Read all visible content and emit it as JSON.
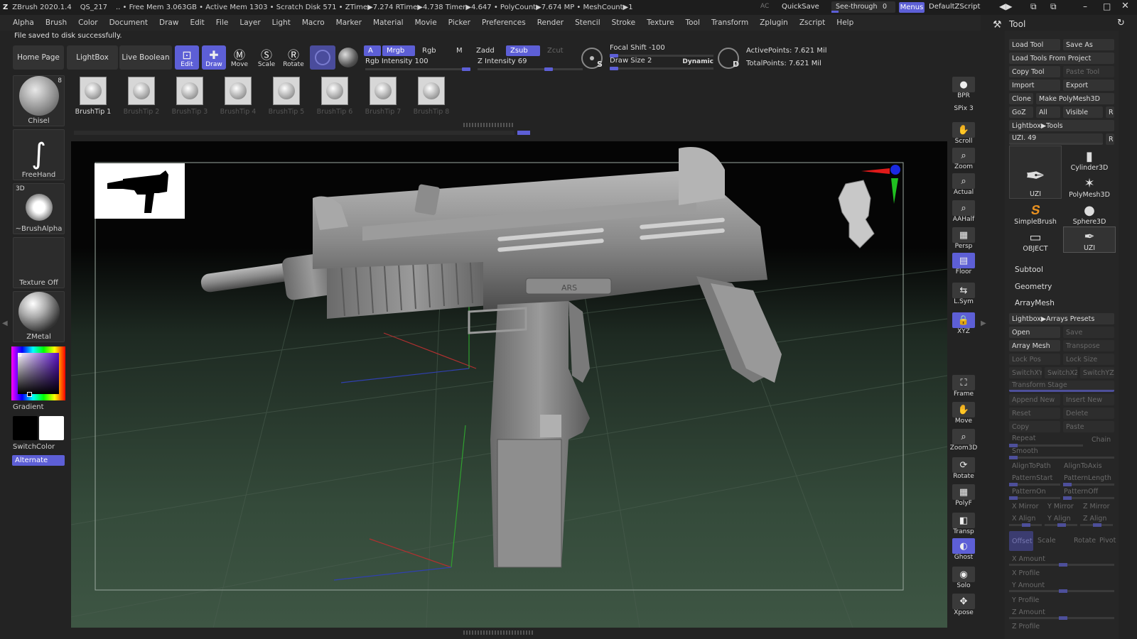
{
  "titlebar": {
    "app": "ZBrush 2020.1.4",
    "doc": "QS_217",
    "stats": ".. • Free Mem 3.063GB • Active Mem 1303 • Scratch Disk 571 • ZTime▶7.274 RTime▶4.738 Timer▶4.647 • PolyCount▶7.674 MP • MeshCount▶1",
    "ac": "AC",
    "quicksave": "QuickSave",
    "seethrough": "See-through",
    "seethrough_value": "0",
    "menus": "Menus",
    "script": "DefaultZScript"
  },
  "menubar": [
    "Alpha",
    "Brush",
    "Color",
    "Document",
    "Draw",
    "Edit",
    "File",
    "Layer",
    "Light",
    "Macro",
    "Marker",
    "Material",
    "Movie",
    "Picker",
    "Preferences",
    "Render",
    "Stencil",
    "Stroke",
    "Texture",
    "Tool",
    "Transform",
    "Zplugin",
    "Zscript",
    "Help"
  ],
  "status": "File saved to disk successfully.",
  "topbar": {
    "home": "Home Page",
    "lightbox": "LightBox",
    "liveboolean": "Live Boolean",
    "modes": [
      "Edit",
      "Draw",
      "Move",
      "Scale",
      "Rotate"
    ],
    "a": "A",
    "mrgb": "Mrgb",
    "rgb": "Rgb",
    "m": "M",
    "zadd": "Zadd",
    "zsub": "Zsub",
    "zcut": "Zcut",
    "rgb_intensity": "Rgb Intensity 100",
    "z_intensity": "Z Intensity 69",
    "focal_shift": "Focal Shift -100",
    "draw_size": "Draw Size 2",
    "dynamic": "Dynamic",
    "s": "S",
    "d": "D",
    "active_points": "ActivePoints: 7.621 Mil",
    "total_points": "TotalPoints: 7.621 Mil",
    "rgb_intensity_level": 1.0,
    "z_intensity_level": 0.69
  },
  "left": {
    "brush": "Chisel",
    "brush_count": "8",
    "stroke": "FreeHand",
    "alpha_tag": "3D",
    "alpha": "~BrushAlpha",
    "texture": "Texture Off",
    "material": "ZMetal",
    "gradient": "Gradient",
    "switchcolor": "SwitchColor",
    "alternate": "Alternate"
  },
  "brushtips": [
    "BrushTip 1",
    "BrushTip 2",
    "BrushTip 3",
    "BrushTip 4",
    "BrushTip 5",
    "BrushTip 6",
    "BrushTip 7",
    "BrushTip 8"
  ],
  "viewport": {
    "stamp": "ARS"
  },
  "rightshelf": [
    {
      "label": "BPR",
      "icon": "sphere-icon"
    },
    {
      "label": "SPix 3",
      "icon": "none"
    },
    {
      "label": "Scroll",
      "icon": "hand-icon"
    },
    {
      "label": "Zoom",
      "icon": "zoom-icon"
    },
    {
      "label": "Actual",
      "icon": "zoom-icon"
    },
    {
      "label": "AAHalf",
      "icon": "zoom-icon"
    },
    {
      "label": "Persp",
      "icon": "grid-icon"
    },
    {
      "label": "Floor",
      "icon": "floor-icon"
    },
    {
      "label": "L.Sym",
      "icon": "sym-icon"
    },
    {
      "label": "XYZ",
      "icon": "lock-icon"
    },
    {
      "label": "Frame",
      "icon": "frame-icon"
    },
    {
      "label": "Move",
      "icon": "hand-icon"
    },
    {
      "label": "Zoom3D",
      "icon": "zoom-icon"
    },
    {
      "label": "Rotate",
      "icon": "rotate-icon"
    },
    {
      "label": "PolyF",
      "icon": "grid-icon"
    },
    {
      "label": "Transp",
      "icon": "transp-icon"
    },
    {
      "label": "Ghost",
      "icon": "ghost-icon"
    },
    {
      "label": "Solo",
      "icon": "solo-icon"
    },
    {
      "label": "Xpose",
      "icon": "xpose-icon"
    }
  ],
  "tool": {
    "title": "Tool",
    "load_tool": "Load Tool",
    "save_as": "Save As",
    "load_from_project": "Load Tools From Project",
    "copy_tool": "Copy Tool",
    "paste_tool": "Paste Tool",
    "import": "Import",
    "export": "Export",
    "clone": "Clone",
    "make_polymesh": "Make PolyMesh3D",
    "goz": "GoZ",
    "all": "All",
    "visible": "Visible",
    "r": "R",
    "lightbox_tools": "Lightbox▶Tools",
    "uzi_slider": "UZI. 49",
    "tiles": [
      "UZI",
      "Cylinder3D",
      "PolyMesh3D",
      "SimpleBrush",
      "Sphere3D",
      "OBJECT",
      "UZI"
    ],
    "subtool": "Subtool",
    "geometry": "Geometry",
    "arraymesh": "ArrayMesh",
    "arrays_presets": "Lightbox▶Arrays Presets",
    "open": "Open",
    "save": "Save",
    "array_mesh": "Array Mesh",
    "transpose": "Transpose",
    "lock_pos": "Lock Pos",
    "lock_size": "Lock Size",
    "switch_xy": "SwitchXY",
    "switch_xz": "SwitchXZ",
    "switch_yz": "SwitchYZ",
    "transform_stage": "Transform Stage",
    "append_new": "Append New",
    "insert_new": "Insert New",
    "reset": "Reset",
    "delete": "Delete",
    "copy": "Copy",
    "paste": "Paste",
    "repeat": "Repeat",
    "chain": "Chain",
    "smooth": "Smooth",
    "align_to_path": "AlignToPath",
    "align_to_axis": "AlignToAxis",
    "pattern_start": "PatternStart",
    "pattern_length": "PatternLength",
    "pattern_on": "PatternOn",
    "pattern_off": "PatternOff",
    "x_mirror": "X Mirror",
    "y_mirror": "Y Mirror",
    "z_mirror": "Z Mirror",
    "x_align": "X Align",
    "y_align": "Y Align",
    "z_align": "Z Align",
    "offset": "Offset",
    "scale": "Scale",
    "rotate": "Rotate",
    "pivot": "Pivot",
    "x_amount": "X Amount",
    "x_profile": "X Profile",
    "y_amount": "Y Amount",
    "y_profile": "Y Profile",
    "z_amount": "Z Amount",
    "z_profile": "Z Profile"
  },
  "colors": {
    "accent": "#5d5fd6",
    "panel": "#262626",
    "viewport_floor": "#3a4a3e"
  }
}
